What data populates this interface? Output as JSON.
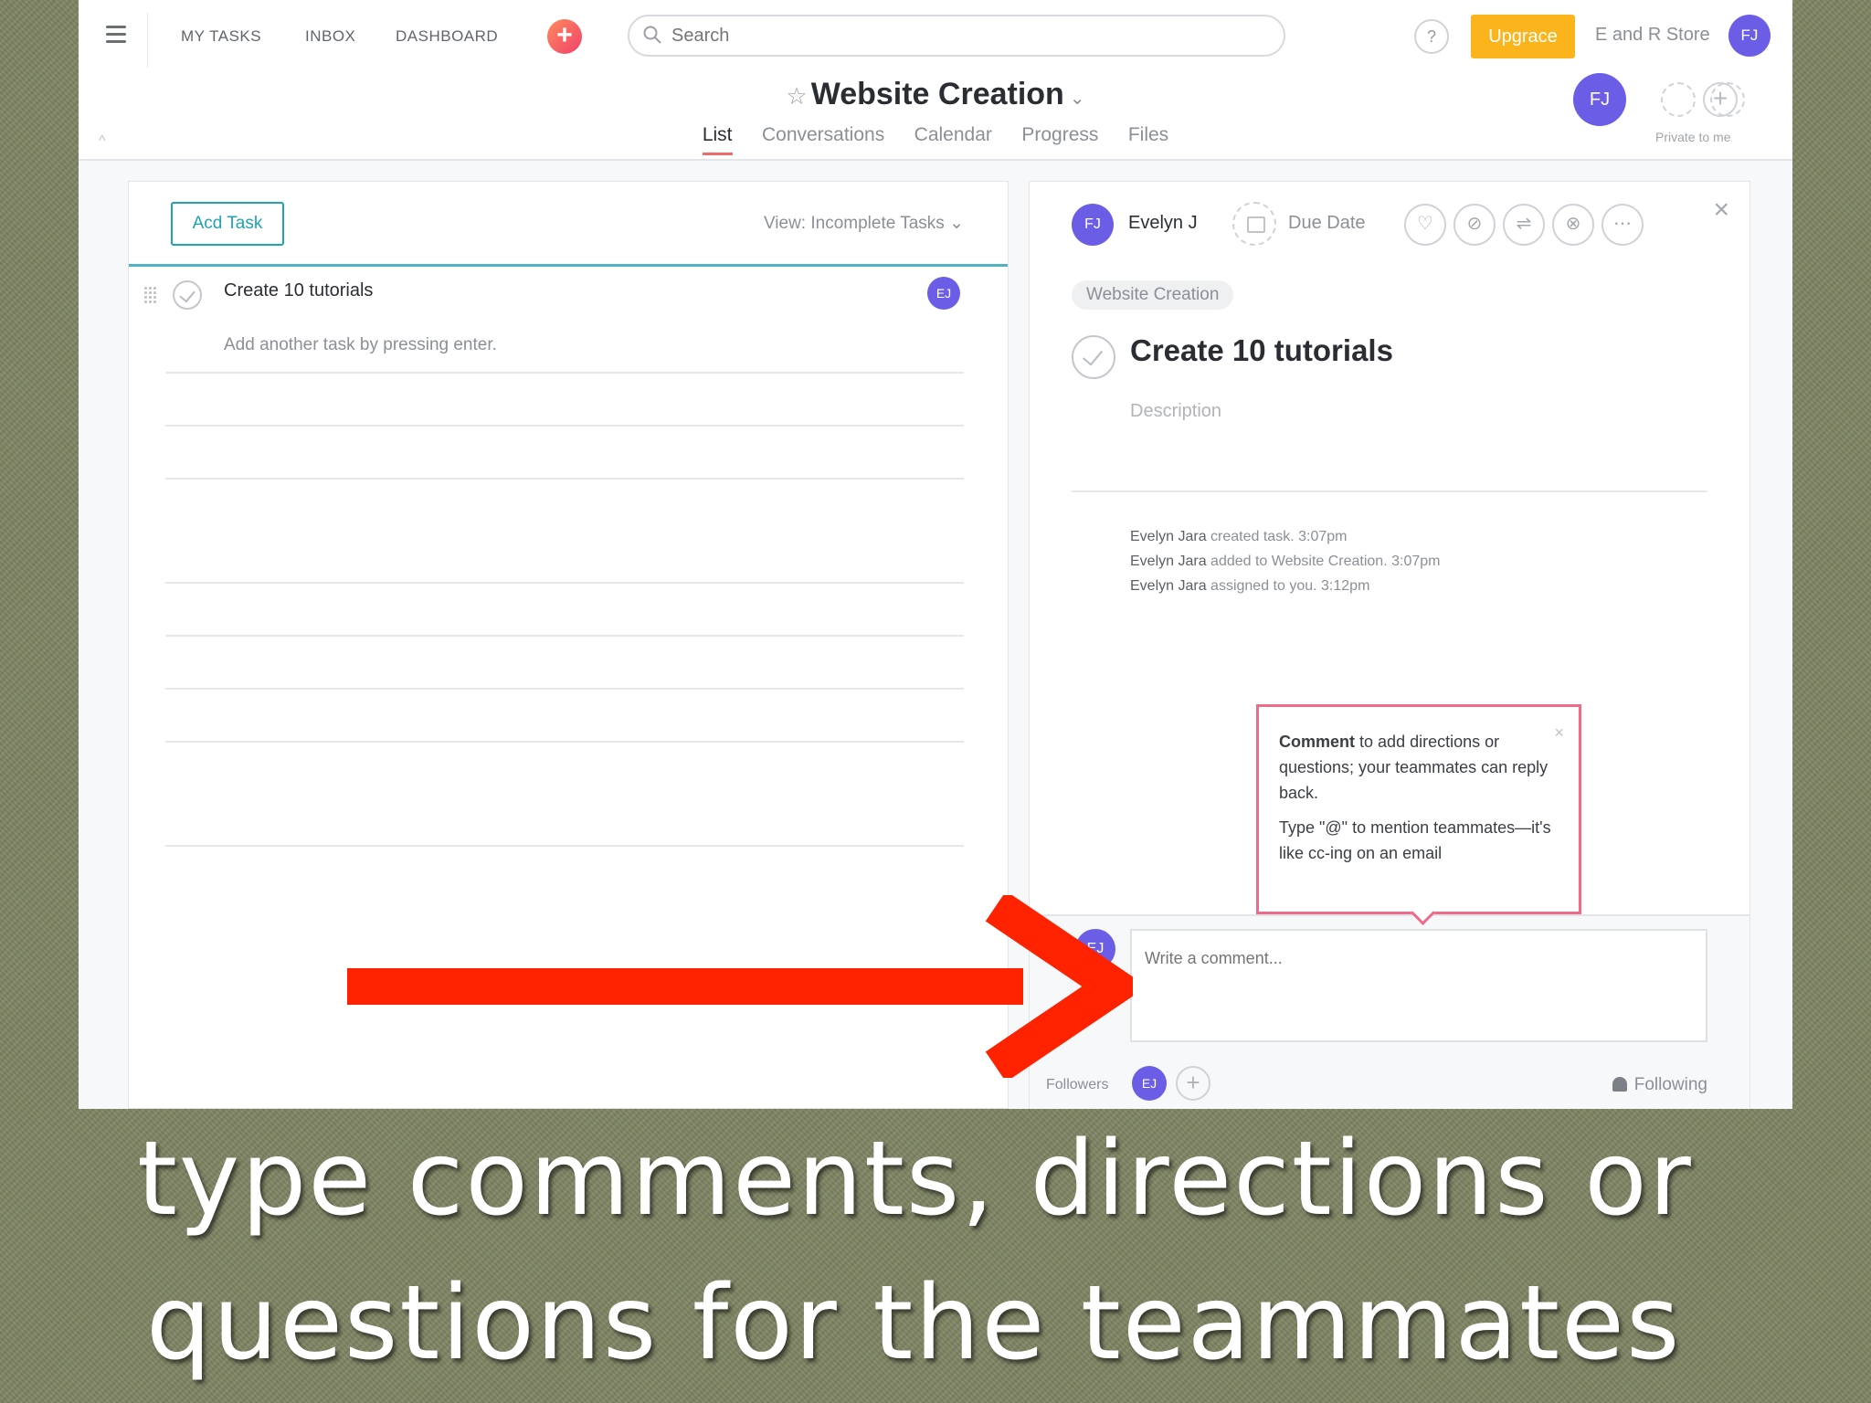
{
  "topbar": {
    "nav": [
      "MY TASKS",
      "INBOX",
      "DASHBOARD"
    ],
    "search_placeholder": "Search",
    "help": "?",
    "upgrade": "Upgrace",
    "workspace": "E and R Store",
    "user_initials": "FJ"
  },
  "project": {
    "title": "Website Creation",
    "tabs": [
      "List",
      "Conversations",
      "Calendar",
      "Progress",
      "Files"
    ],
    "active_tab": "List",
    "member_initials": "FJ",
    "privacy": "Private to me"
  },
  "list": {
    "add_task": "Acd Task",
    "view": "View: Incomplete Tasks",
    "tasks": [
      {
        "name": "Create 10 tutorials",
        "assignee": "EJ"
      }
    ],
    "add_hint": "Add another task by pressing enter."
  },
  "detail": {
    "assignee_initials": "FJ",
    "assignee": "Evelyn J",
    "due_date": "Due Date",
    "project_pill": "Website Creation",
    "title": "Create 10 tutorials",
    "description_placeholder": "Description",
    "activity": [
      {
        "who": "Evelyn Jara",
        "what": "created task.",
        "when": "3:07pm"
      },
      {
        "who": "Evelyn Jara",
        "what": "added to Website Creation.",
        "when": "3:07pm"
      },
      {
        "who": "Evelyn Jara",
        "what": "assigned to you.",
        "when": "3:12pm"
      }
    ],
    "tooltip": {
      "bold": "Comment",
      "line1": "to add directions or questions; your teammates can reply back.",
      "line2": "Type \"@\" to mention teammates—it's like cc-ing on an email"
    },
    "comment_initials": "EJ",
    "comment_placeholder": "Write a comment...",
    "followers_label": "Followers",
    "follower_initials": "EJ",
    "following": "Following"
  },
  "colors": {
    "accent_arrow": "#ff2200",
    "avatar": "#6b5de6",
    "upgrade": "#fcb41d",
    "active_tab": "#f06a6a",
    "tooltip_border": "#f06a8a"
  },
  "caption": {
    "line1": "type comments, directions or",
    "line2": "questions for the teammates"
  }
}
